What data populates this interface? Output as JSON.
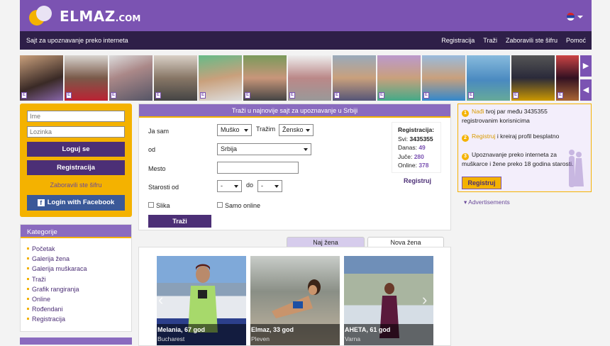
{
  "header": {
    "logo_main": "ELMAZ",
    "logo_suffix": ".COM",
    "tagline": "Sajt za upoznavanje preko interneta",
    "nav": [
      "Registracija",
      "Traži",
      "Zaboravili ste šifru",
      "Pomoć"
    ],
    "language_icon": "serbia-flag-icon"
  },
  "photo_strip": {
    "badge": "E",
    "next_arrow": "▶",
    "prev_arrow": "◀"
  },
  "login": {
    "username_placeholder": "Ime",
    "password_placeholder": "Lozinka",
    "login_button": "Loguj se",
    "register_button": "Registracija",
    "forgot_link": "Zaboravili ste šifru",
    "facebook_button": "Login with Facebook"
  },
  "categories": {
    "title": "Kategorije",
    "items": [
      "Početak",
      "Galerija žena",
      "Galerija muškaraca",
      "Traži",
      "Grafik rangiranja",
      "Online",
      "Rođendani",
      "Registracija"
    ]
  },
  "search": {
    "title": "Traži u najnovije sajt za upoznavanje u Srbiji",
    "i_am_label": "Ja sam",
    "i_am_value": "Muško",
    "seeking_label": "Tražim",
    "seeking_value": "Žensko",
    "from_label": "od",
    "country_value": "Srbija",
    "city_label": "Mesto",
    "city_value": "",
    "age_label": "Starosti od",
    "age_from": "-",
    "age_to_label": "do",
    "age_to": "-",
    "photo_label": "Slika",
    "online_label": "Samo online",
    "search_button": "Traži"
  },
  "stats": {
    "title": "Registracija:",
    "total_label": "Svi:",
    "total": "3435355",
    "today_label": "Danas:",
    "today": "49",
    "yesterday_label": "Juče:",
    "yesterday": "280",
    "online_label": "Online:",
    "online": "378",
    "register_link": "Registruj"
  },
  "info": {
    "step1_link": "Nađi",
    "step1_text": "tvoj par među 3435355 registrovanim korisnicima",
    "step2_link": "Registruj",
    "step2_text": "i kreiraj profil besplatno",
    "step3_text": "Upoznavanje preko interneta za muškarce i žene preko 18 godina starosti.",
    "button": "Registruj",
    "ads_link": "▾ Advertisements"
  },
  "tabs": [
    "Naj žena",
    "Nova žena"
  ],
  "gallery": [
    {
      "name": "Melania, 67 god",
      "city": "Bucharest"
    },
    {
      "name": "Elmaz, 33 god",
      "city": "Pleven"
    },
    {
      "name": "AHETA, 61 god",
      "city": "Varna"
    }
  ],
  "colors": {
    "brand_purple": "#7b53b2",
    "dark_purple": "#4c2f76",
    "accent_gold": "#f4b200",
    "facebook": "#3b5998"
  }
}
